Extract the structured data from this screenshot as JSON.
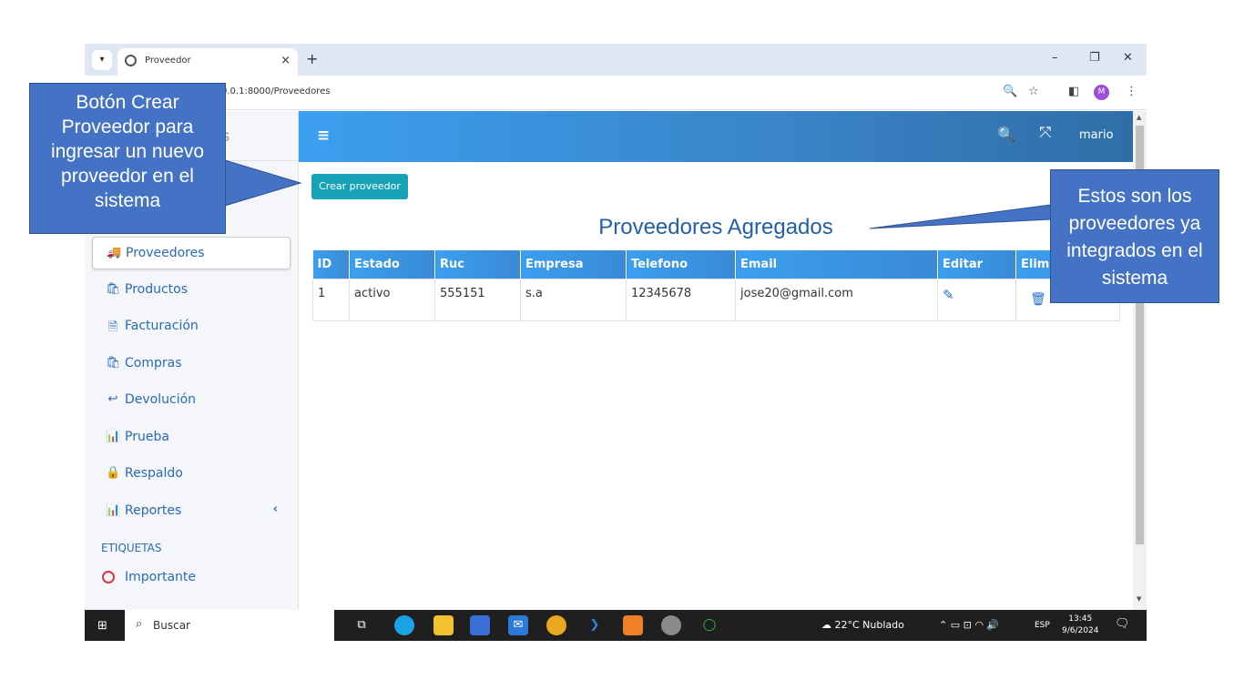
{
  "browser": {
    "tab_title": "Proveedor",
    "tab_close": "×",
    "new_tab": "+",
    "url": "0.0.1:8000/Proveedores",
    "profile_initial": "M"
  },
  "sidebar": {
    "brand_partial": "es",
    "items": [
      {
        "label": "Proveedores",
        "icon": "truck-icon",
        "glyph": "🚚"
      },
      {
        "label": "Productos",
        "icon": "bag-icon",
        "glyph": "🛍"
      },
      {
        "label": "Facturación",
        "icon": "invoice-icon",
        "glyph": "🗎"
      },
      {
        "label": "Compras",
        "icon": "bag-icon",
        "glyph": "🛍"
      },
      {
        "label": "Devolución",
        "icon": "reply-icon",
        "glyph": "↩"
      },
      {
        "label": "Prueba",
        "icon": "chart-icon",
        "glyph": "📊"
      },
      {
        "label": "Respaldo",
        "icon": "lock-icon",
        "glyph": "🔒"
      },
      {
        "label": "Reportes",
        "icon": "chart-icon",
        "glyph": "📊"
      }
    ],
    "labels_header": "ETIQUETAS",
    "label_item": "Importante"
  },
  "topbar": {
    "username": "mario"
  },
  "main": {
    "create_button": "Crear proveedor",
    "title": "Proveedores Agregados",
    "table": {
      "headers": [
        "ID",
        "Estado",
        "Ruc",
        "Empresa",
        "Telefono",
        "Email",
        "Editar",
        "Elimi"
      ],
      "rows": [
        {
          "id": "1",
          "estado": "activo",
          "ruc": "555151",
          "empresa": "s.a",
          "telefono": "12345678",
          "email": "jose20@gmail.com"
        }
      ]
    }
  },
  "taskbar": {
    "search_label": "Buscar",
    "weather": "22°C  Nublado",
    "language": "ESP",
    "time": "13:45",
    "date": "9/6/2024"
  },
  "callouts": {
    "left": "Botón Crear Proveedor para ingresar un nuevo proveedor en el sistema",
    "right": "Estos son los proveedores ya integrados en el sistema"
  },
  "colors": {
    "accent": "#3a8ad6",
    "button": "#17a2b8",
    "callout": "#4472c4"
  }
}
